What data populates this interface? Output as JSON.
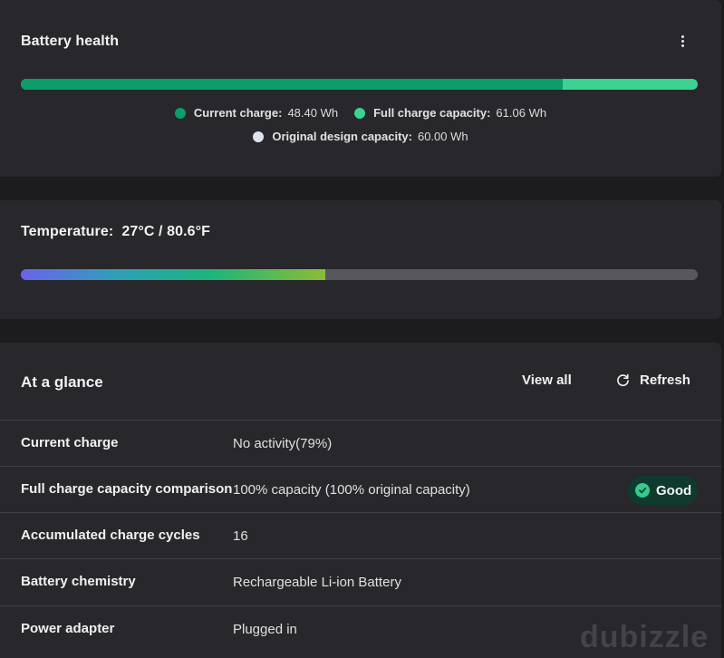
{
  "battery_health": {
    "title": "Battery health",
    "bar": {
      "current_fraction": 0.801,
      "current_color": "#0b9d6a",
      "full_color": "#3ad392"
    },
    "legend": [
      {
        "label": "Current charge:",
        "value": "48.40 Wh",
        "color": "#0b9d6a"
      },
      {
        "label": "Full charge capacity:",
        "value": "61.06 Wh",
        "color": "#3ad392"
      },
      {
        "label": "Original design capacity:",
        "value": "60.00 Wh",
        "color": "#dde3ee"
      }
    ]
  },
  "temperature": {
    "title": "Temperature:  27°C / 80.6°F",
    "bar_fraction": 0.45
  },
  "at_a_glance": {
    "title": "At a glance",
    "view_all_label": "View all",
    "refresh_label": "Refresh",
    "rows": [
      {
        "label": "Current charge",
        "value": "No activity(79%)"
      },
      {
        "label": "Full charge capacity comparison",
        "value": "100% capacity (100% original capacity)",
        "badge": "Good"
      },
      {
        "label": "Accumulated charge cycles",
        "value": "16"
      },
      {
        "label": "Battery chemistry",
        "value": "Rechargeable Li-ion Battery"
      },
      {
        "label": "Power adapter",
        "value": "Plugged in"
      }
    ]
  },
  "watermark": "dubizzle"
}
